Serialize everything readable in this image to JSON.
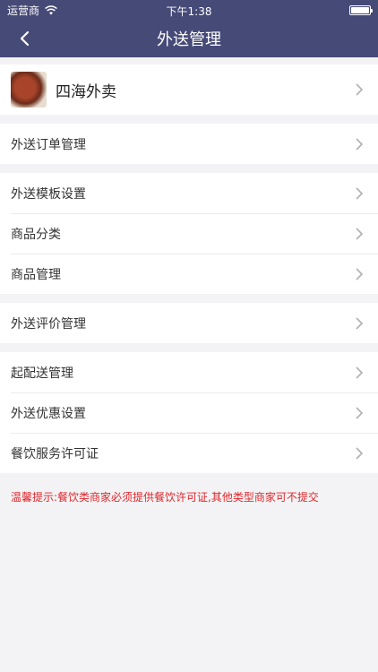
{
  "status": {
    "carrier": "运营商",
    "time": "下午1:38",
    "battery_level": 1.0
  },
  "header": {
    "title": "外送管理"
  },
  "store": {
    "name": "四海外卖"
  },
  "groups": [
    {
      "items": [
        {
          "label": "外送订单管理"
        }
      ]
    },
    {
      "items": [
        {
          "label": "外送模板设置"
        },
        {
          "label": "商品分类"
        },
        {
          "label": "商品管理"
        }
      ]
    },
    {
      "items": [
        {
          "label": "外送评价管理"
        }
      ]
    },
    {
      "items": [
        {
          "label": "起配送管理"
        },
        {
          "label": "外送优惠设置"
        },
        {
          "label": "餐饮服务许可证"
        }
      ]
    }
  ],
  "notice": "温馨提示:餐饮类商家必须提供餐饮许可证,其他类型商家可不提交",
  "colors": {
    "header_bg": "#454a77",
    "notice": "#e0262b"
  }
}
